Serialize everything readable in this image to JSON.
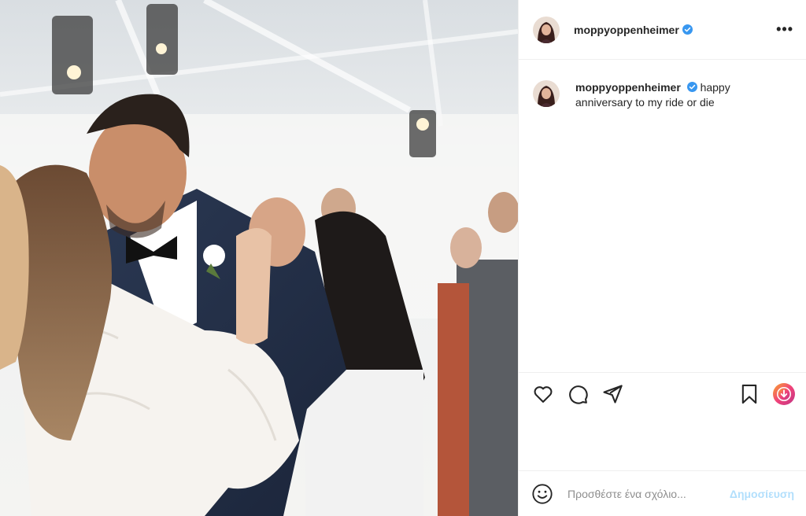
{
  "post": {
    "username": "moppyoppenheimer",
    "verified": true,
    "more_icon": "ellipsis-icon",
    "caption_username": "moppyoppenheimer",
    "caption_text": "happy anniversary to my ride or die"
  },
  "actions": {
    "like": "heart-icon",
    "comment": "comment-bubble-icon",
    "share": "paper-plane-icon",
    "save": "bookmark-icon",
    "extra": "download-badge-icon"
  },
  "comment_box": {
    "emoji_icon": "smiley-icon",
    "placeholder": "Προσθέστε ένα σχόλιο...",
    "post_label": "Δημοσίευση"
  },
  "colors": {
    "verified": "#3897f0",
    "post_button_disabled": "#b2dffc",
    "text": "#262626"
  }
}
